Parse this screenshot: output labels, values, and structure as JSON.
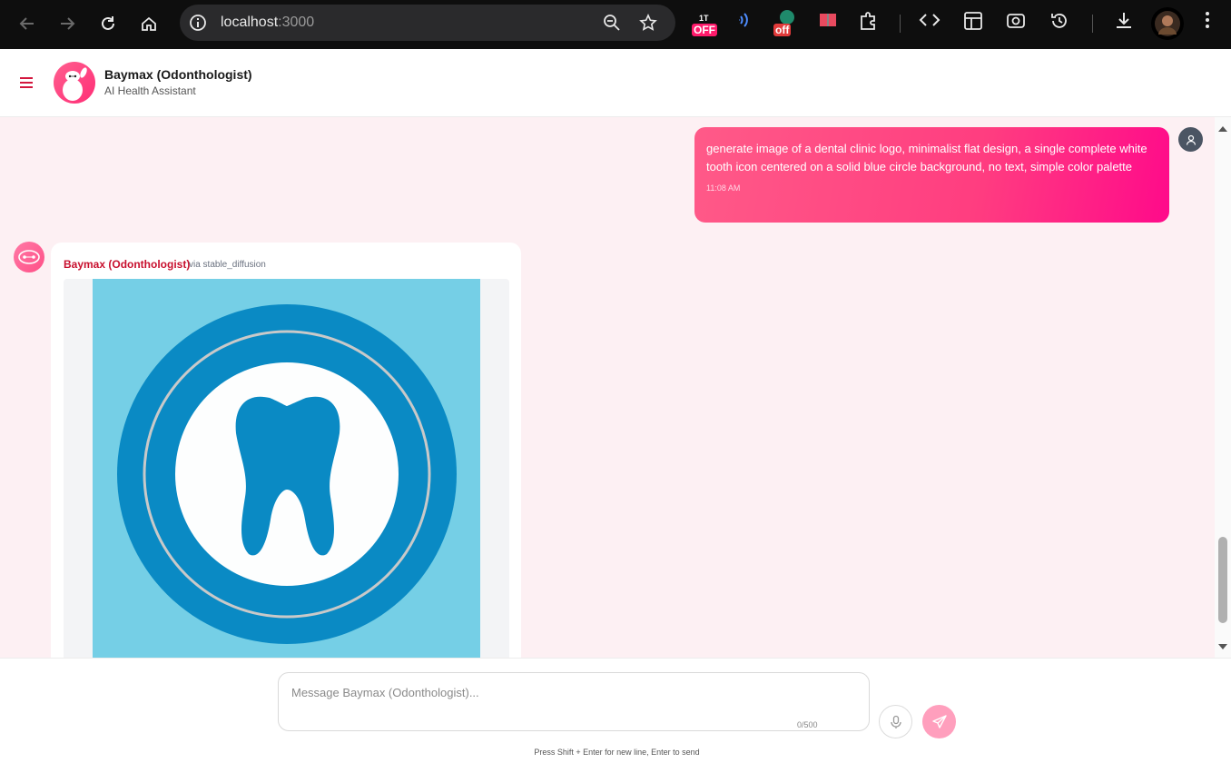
{
  "browser": {
    "url_host": "localhost",
    "url_port": ":3000",
    "ext_badge_1": "OFF",
    "ext_badge_1_top": "1T",
    "ext_badge_2": "off"
  },
  "header": {
    "title": "Baymax (Odonthologist)",
    "subtitle": "AI Health Assistant",
    "accent": "#ff2d76"
  },
  "chat": {
    "user_message": {
      "text": "generate image of a dental clinic logo, minimalist flat design, a single complete white tooth icon centered on a solid blue circle background, no text, simple color palette",
      "time": "11:08 AM"
    },
    "bot_message": {
      "name": "Baymax (Odonthologist)",
      "via": "via stable_diffusion",
      "image_icon": "tooth-logo-image"
    }
  },
  "composer": {
    "placeholder": "Message Baymax (Odonthologist)...",
    "counter": "0/500",
    "hint": "Press Shift + Enter for new line, Enter to send"
  }
}
